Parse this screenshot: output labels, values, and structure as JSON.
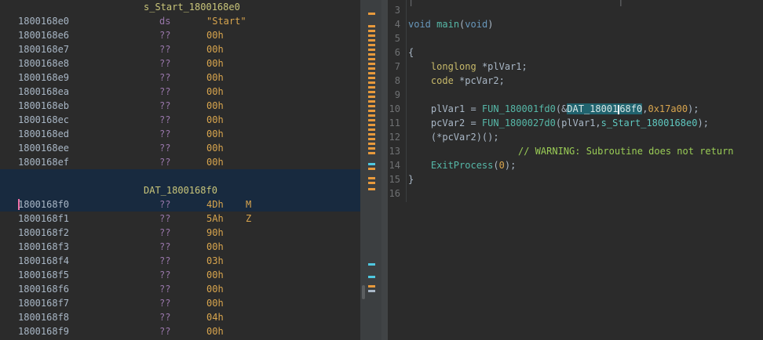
{
  "listing": {
    "label_top": "s_Start_1800168e0",
    "label_mid": "DAT_1800168f0",
    "rows_a": [
      {
        "addr": "1800168e0",
        "mnem": "ds",
        "val": "\"Start\"",
        "chr": ""
      },
      {
        "addr": "1800168e6",
        "mnem": "??",
        "val": "00h",
        "chr": ""
      },
      {
        "addr": "1800168e7",
        "mnem": "??",
        "val": "00h",
        "chr": ""
      },
      {
        "addr": "1800168e8",
        "mnem": "??",
        "val": "00h",
        "chr": ""
      },
      {
        "addr": "1800168e9",
        "mnem": "??",
        "val": "00h",
        "chr": ""
      },
      {
        "addr": "1800168ea",
        "mnem": "??",
        "val": "00h",
        "chr": ""
      },
      {
        "addr": "1800168eb",
        "mnem": "??",
        "val": "00h",
        "chr": ""
      },
      {
        "addr": "1800168ec",
        "mnem": "??",
        "val": "00h",
        "chr": ""
      },
      {
        "addr": "1800168ed",
        "mnem": "??",
        "val": "00h",
        "chr": ""
      },
      {
        "addr": "1800168ee",
        "mnem": "??",
        "val": "00h",
        "chr": ""
      },
      {
        "addr": "1800168ef",
        "mnem": "??",
        "val": "00h",
        "chr": ""
      }
    ],
    "rows_b": [
      {
        "addr": "1800168f0",
        "mnem": "??",
        "val": "4Dh",
        "chr": "M"
      },
      {
        "addr": "1800168f1",
        "mnem": "??",
        "val": "5Ah",
        "chr": "Z"
      },
      {
        "addr": "1800168f2",
        "mnem": "??",
        "val": "90h",
        "chr": ""
      },
      {
        "addr": "1800168f3",
        "mnem": "??",
        "val": "00h",
        "chr": ""
      },
      {
        "addr": "1800168f4",
        "mnem": "??",
        "val": "03h",
        "chr": ""
      },
      {
        "addr": "1800168f5",
        "mnem": "??",
        "val": "00h",
        "chr": ""
      },
      {
        "addr": "1800168f6",
        "mnem": "??",
        "val": "00h",
        "chr": ""
      },
      {
        "addr": "1800168f7",
        "mnem": "??",
        "val": "00h",
        "chr": ""
      },
      {
        "addr": "1800168f8",
        "mnem": "??",
        "val": "04h",
        "chr": ""
      },
      {
        "addr": "1800168f9",
        "mnem": "??",
        "val": "00h",
        "chr": ""
      }
    ]
  },
  "decompiler": {
    "line_numbers": [
      "3",
      "4",
      "5",
      "6",
      "7",
      "8",
      "9",
      "10",
      "11",
      "12",
      "13",
      "14",
      "15",
      "16"
    ],
    "void_kw": "void",
    "main_fn": "main",
    "brace_open": "{",
    "brace_close": "}",
    "type_longlong": "longlong",
    "decl1_var": "*plVar1;",
    "type_code": "code",
    "decl2_var": "*pcVar2;",
    "fun1": "FUN_180001fd0",
    "dat_sym_a": "DAT_18001",
    "dat_sym_b": "68f0",
    "hex_arg": "0x17a00",
    "fun2": "FUN_1800027d0",
    "s_start_sym": "s_Start_1800168e0",
    "call_expr": "(*pcVar2)();",
    "warning": "// WARNING: Subroutine does not return",
    "exit_fn": "ExitProcess",
    "zero": "0"
  },
  "colors": {
    "bg_pane": "#2b2b2b",
    "selection_row": "#182a3f",
    "symbol_highlight": "#21636e",
    "overview_orange": "#e89a3c",
    "overview_cyan": "#4fc8e0"
  }
}
